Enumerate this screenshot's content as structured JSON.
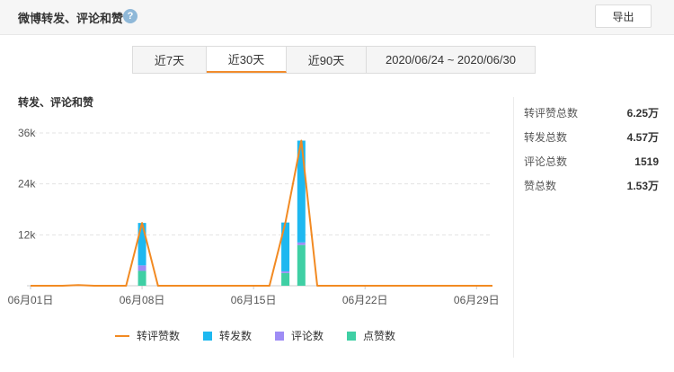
{
  "header": {
    "title": "微博转发、评论和赞",
    "help_icon": "question-mark-icon",
    "export_label": "导出"
  },
  "tabs": [
    {
      "label": "近7天",
      "active": false
    },
    {
      "label": "近30天",
      "active": true
    },
    {
      "label": "近90天",
      "active": false
    },
    {
      "label": "2020/06/24 ~ 2020/06/30",
      "active": false
    }
  ],
  "section_title": "转发、评论和赞",
  "stats": [
    {
      "label": "转评赞总数",
      "value": "6.25万"
    },
    {
      "label": "转发总数",
      "value": "4.57万"
    },
    {
      "label": "评论总数",
      "value": "1519"
    },
    {
      "label": "赞总数",
      "value": "1.53万"
    }
  ],
  "legend": [
    {
      "name": "转评赞数",
      "color": "#f28a22",
      "kind": "line"
    },
    {
      "name": "转发数",
      "color": "#1eb8f0",
      "kind": "box"
    },
    {
      "name": "评论数",
      "color": "#9e8cf5",
      "kind": "box"
    },
    {
      "name": "点赞数",
      "color": "#3fcfa4",
      "kind": "box"
    }
  ],
  "chart_data": {
    "type": "bar",
    "stacked": true,
    "y_ticks": [
      "36k",
      "24k",
      "12k"
    ],
    "ylim": [
      0,
      36000
    ],
    "x_ticks": [
      "06月01日",
      "06月08日",
      "06月15日",
      "06月22日",
      "06月29日"
    ],
    "x": [
      "06-01",
      "06-02",
      "06-03",
      "06-04",
      "06-05",
      "06-06",
      "06-07",
      "06-08",
      "06-09",
      "06-10",
      "06-11",
      "06-12",
      "06-13",
      "06-14",
      "06-15",
      "06-16",
      "06-17",
      "06-18",
      "06-19",
      "06-20",
      "06-21",
      "06-22",
      "06-23",
      "06-24",
      "06-25",
      "06-26",
      "06-27",
      "06-28",
      "06-29",
      "06-30"
    ],
    "series": [
      {
        "name": "转发数",
        "values": [
          0,
          0,
          0,
          0,
          0,
          0,
          0,
          10000,
          0,
          0,
          0,
          0,
          0,
          0,
          0,
          0,
          11500,
          24000,
          0,
          0,
          0,
          0,
          0,
          0,
          0,
          0,
          0,
          0,
          0,
          0
        ]
      },
      {
        "name": "评论数",
        "values": [
          0,
          0,
          0,
          0,
          0,
          0,
          0,
          1300,
          0,
          0,
          0,
          0,
          0,
          0,
          0,
          0,
          400,
          600,
          0,
          0,
          0,
          0,
          0,
          0,
          0,
          0,
          0,
          0,
          0,
          0
        ]
      },
      {
        "name": "点赞数",
        "values": [
          0,
          0,
          0,
          0,
          0,
          0,
          0,
          3500,
          0,
          0,
          0,
          0,
          0,
          0,
          0,
          0,
          3000,
          9600,
          0,
          0,
          0,
          0,
          0,
          0,
          0,
          0,
          0,
          0,
          0,
          0
        ]
      },
      {
        "name": "转评赞数",
        "values": [
          0,
          0,
          0,
          150,
          0,
          0,
          0,
          14800,
          0,
          0,
          0,
          0,
          0,
          0,
          0,
          0,
          14900,
          34200,
          0,
          0,
          0,
          0,
          0,
          0,
          0,
          0,
          0,
          0,
          0,
          0
        ]
      }
    ],
    "grid": true
  }
}
